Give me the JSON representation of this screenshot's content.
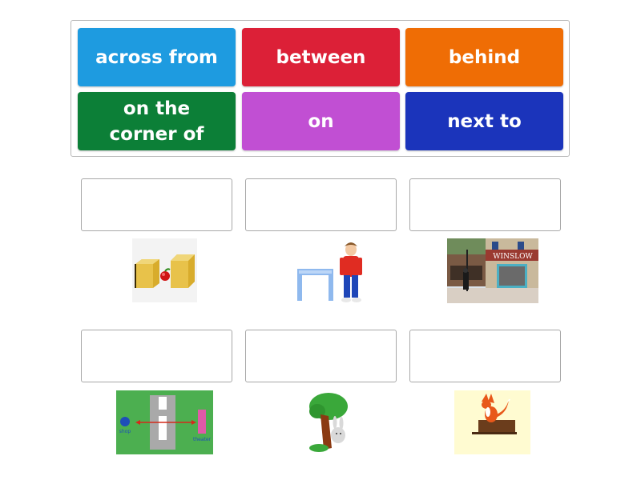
{
  "tiles": [
    {
      "label": "across from",
      "color": "#1e9be0"
    },
    {
      "label": "between",
      "color": "#dc2037"
    },
    {
      "label": "behind",
      "color": "#ef6d05"
    },
    {
      "label": "on the corner of",
      "color": "#0c7f37"
    },
    {
      "label": "on",
      "color": "#c14fd3"
    },
    {
      "label": "next to",
      "color": "#1b34bb"
    }
  ],
  "drop_slots": [
    {
      "value": ""
    },
    {
      "value": ""
    },
    {
      "value": ""
    },
    {
      "value": ""
    },
    {
      "value": ""
    },
    {
      "value": ""
    }
  ],
  "images": [
    {
      "name": "apple-between-boxes"
    },
    {
      "name": "boy-next-to-table"
    },
    {
      "name": "man-on-corner-winslow",
      "sign_text": "WINSLOW"
    },
    {
      "name": "shop-across-from-theater",
      "label_left": "shop",
      "label_right": "theater"
    },
    {
      "name": "rabbit-behind-tree"
    },
    {
      "name": "fox-on-stump"
    }
  ]
}
